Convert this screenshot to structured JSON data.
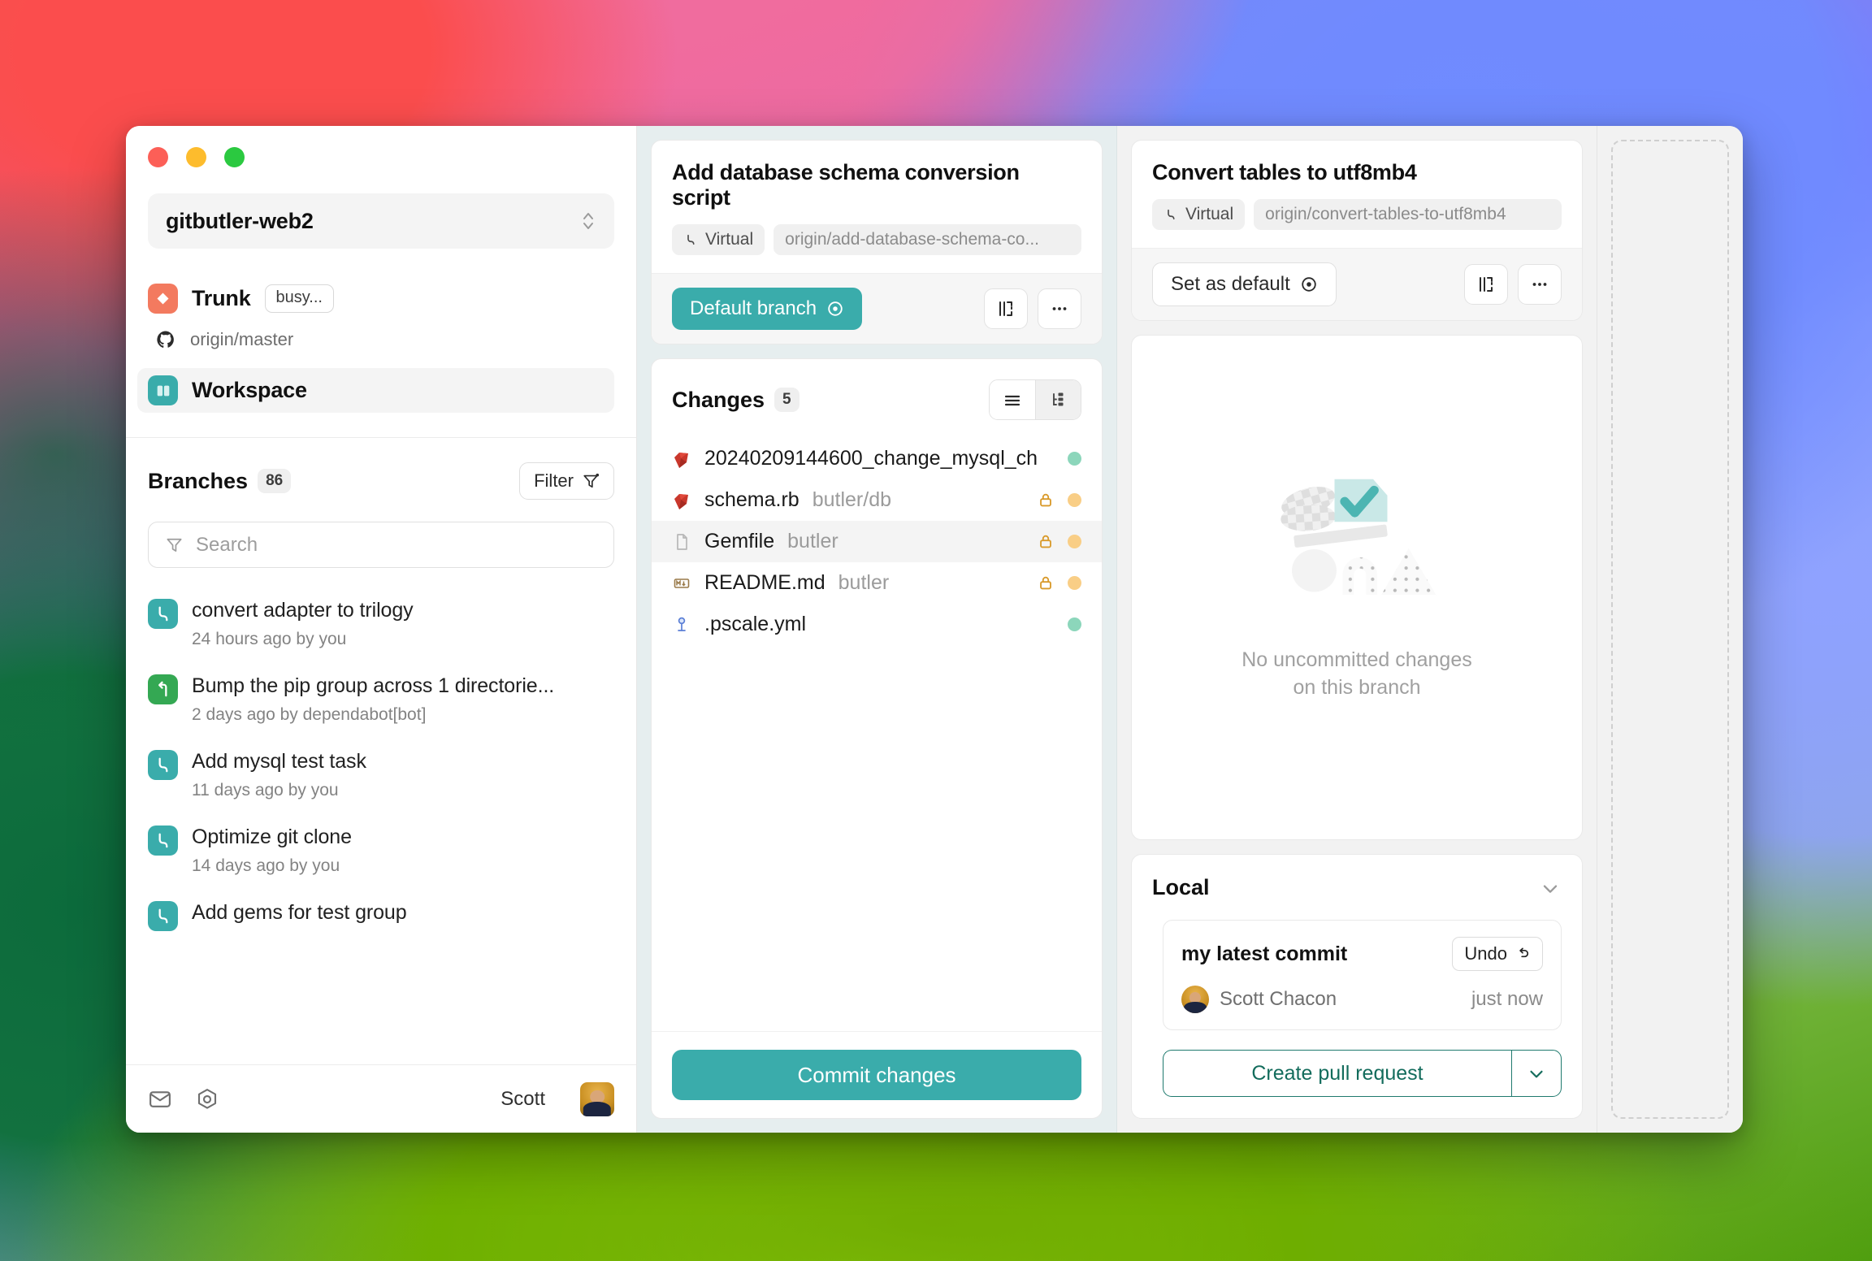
{
  "window": {
    "traffic_lights": [
      "close",
      "minimize",
      "zoom"
    ],
    "colors": {
      "accent": "#3aacab",
      "trunk": "#f37a5f",
      "green": "#34a853",
      "pr_text": "#136c5c"
    }
  },
  "sidebar": {
    "repo": {
      "name": "gitbutler-web2",
      "icon": "chevron-up-down-icon"
    },
    "nav": [
      {
        "label": "Trunk",
        "badge": "busy...",
        "sub_icon": "github-icon",
        "sub": "origin/master",
        "icon": "trunk-icon"
      },
      {
        "label": "Workspace",
        "icon": "workspace-icon",
        "active": true
      }
    ],
    "branches": {
      "title": "Branches",
      "count": "86",
      "filter_label": "Filter",
      "filter_icon": "filter-icon",
      "search": {
        "placeholder": "Search",
        "value": "",
        "icon": "filter-icon"
      },
      "items": [
        {
          "name": "convert adapter to trilogy",
          "meta": "24 hours ago by you",
          "icon": "branch-icon",
          "color": "teal"
        },
        {
          "name": "Bump the pip group across 1 directorie...",
          "meta": "2 days ago by dependabot[bot]",
          "icon": "pull-request-icon",
          "color": "green"
        },
        {
          "name": "Add mysql test task",
          "meta": "11 days ago by you",
          "icon": "branch-icon",
          "color": "teal"
        },
        {
          "name": "Optimize git clone",
          "meta": "14 days ago by you",
          "icon": "branch-icon",
          "color": "teal"
        },
        {
          "name": "Add gems for test group",
          "meta": "",
          "icon": "branch-icon",
          "color": "teal"
        }
      ]
    },
    "footer": {
      "mail_icon": "mail-icon",
      "settings_icon": "settings-icon",
      "user_name": "Scott",
      "avatar": "avatar"
    }
  },
  "lane_a": {
    "branch_card": {
      "title": "Add database schema conversion script",
      "type_pill": {
        "icon": "branch-icon",
        "label": "Virtual"
      },
      "remote_pill": "origin/add-database-schema-co...",
      "primary_button": {
        "label": "Default branch",
        "icon": "target-icon"
      },
      "split_icon": "split-view-icon",
      "more_icon": "more-horizontal-icon"
    },
    "changes": {
      "title": "Changes",
      "count": "5",
      "view_list_icon": "list-view-icon",
      "view_tree_icon": "tree-view-icon",
      "files": [
        {
          "name": "20240209144600_change_mysql_ch",
          "path": "",
          "icon": "ruby-icon",
          "locked": false,
          "status": "green"
        },
        {
          "name": "schema.rb",
          "path": "butler/db",
          "icon": "ruby-icon",
          "locked": true,
          "status": "amber"
        },
        {
          "name": "Gemfile",
          "path": "butler",
          "icon": "file-icon",
          "locked": true,
          "status": "amber",
          "selected": true
        },
        {
          "name": "README.md",
          "path": "butler",
          "icon": "markdown-icon",
          "locked": true,
          "status": "amber"
        },
        {
          "name": ".pscale.yml",
          "path": "",
          "icon": "planetscale-icon",
          "locked": false,
          "status": "green"
        }
      ],
      "commit_button": "Commit changes"
    }
  },
  "lane_b": {
    "branch_card": {
      "title": "Convert tables to utf8mb4",
      "type_pill": {
        "icon": "branch-icon",
        "label": "Virtual"
      },
      "remote_pill": "origin/convert-tables-to-utf8mb4",
      "primary_button": {
        "label": "Set as default",
        "icon": "target-icon"
      },
      "split_icon": "split-view-icon",
      "more_icon": "more-horizontal-icon"
    },
    "empty_state": {
      "illustration": "no-changes-illustration",
      "line1": "No uncommitted changes",
      "line2": "on this branch"
    },
    "local": {
      "title": "Local",
      "collapse_icon": "chevron-down-icon",
      "commit": {
        "message": "my latest commit",
        "undo_label": "Undo",
        "undo_icon": "undo-icon",
        "author": "Scott Chacon",
        "time": "just now",
        "avatar": "avatar"
      },
      "pr_button": "Create pull request",
      "pr_caret_icon": "chevron-down-icon"
    }
  },
  "lane_c": {
    "dropzone": "new-lane-dropzone"
  }
}
